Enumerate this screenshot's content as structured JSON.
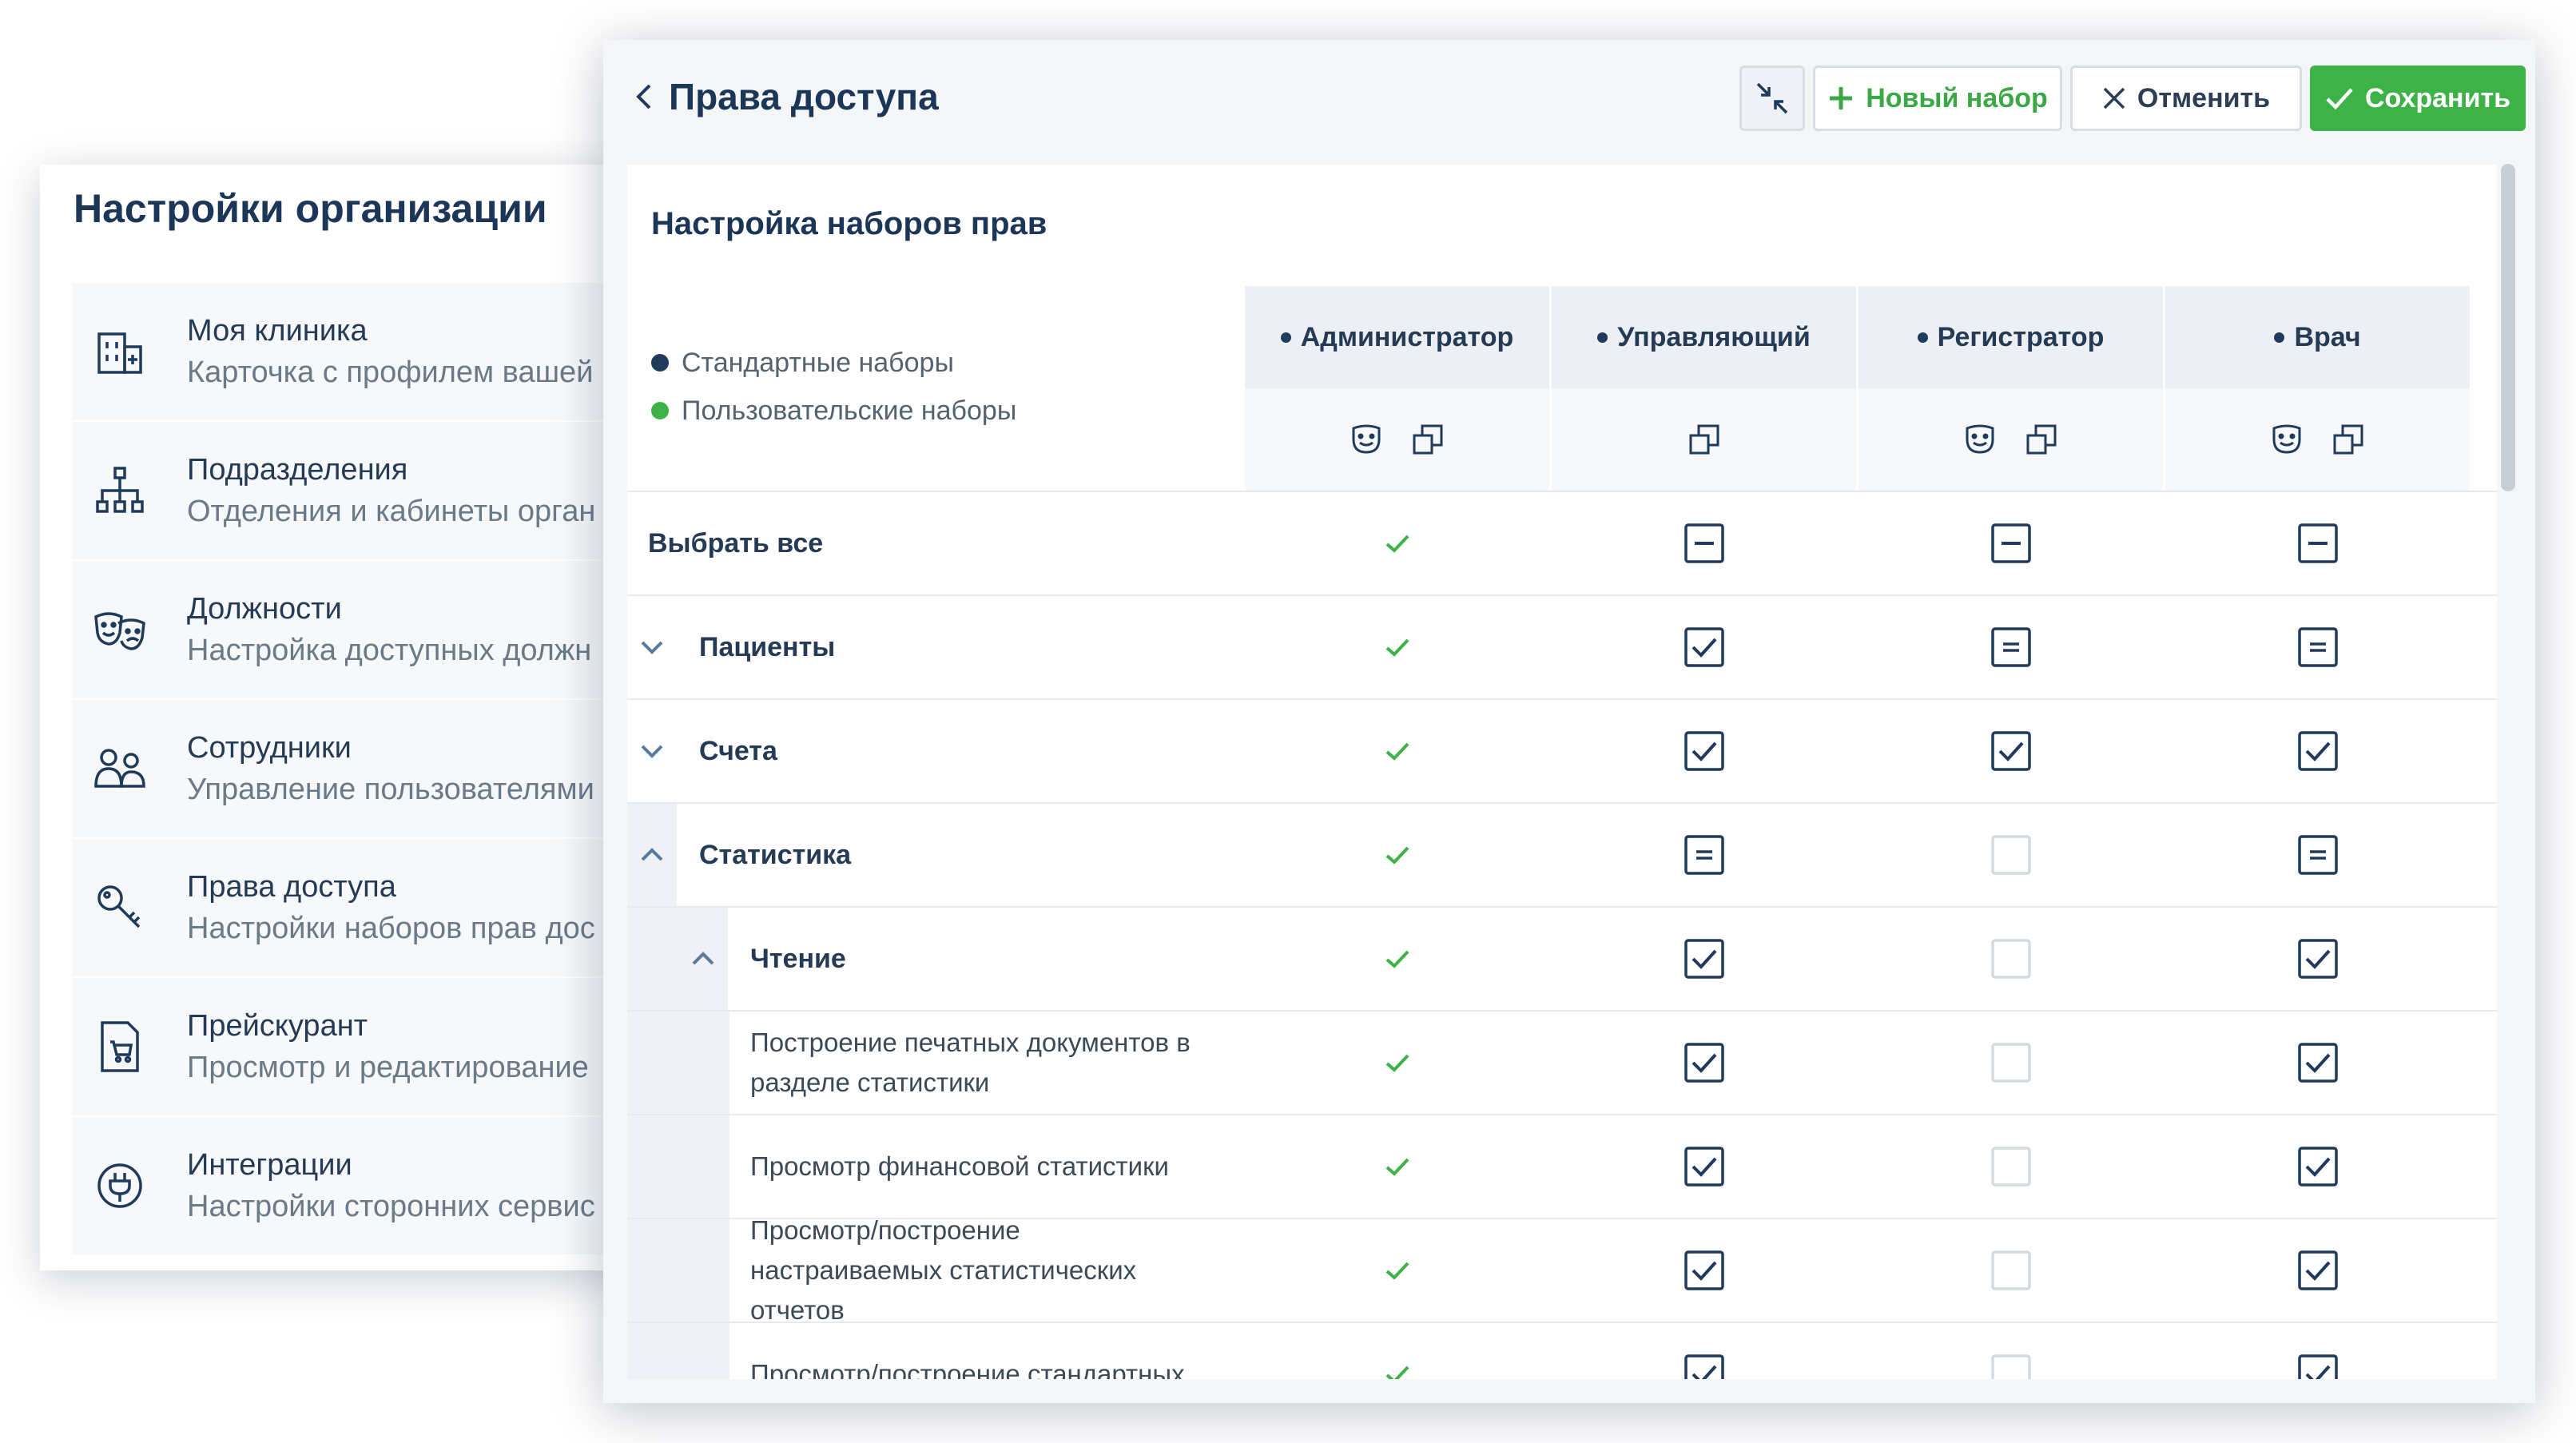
{
  "org_panel": {
    "title": "Настройки организации",
    "items": [
      {
        "icon": "building-icon",
        "name": "Моя клиника",
        "desc": "Карточка с профилем вашей"
      },
      {
        "icon": "hierarchy-icon",
        "name": "Подразделения",
        "desc": "Отделения и кабинеты орган"
      },
      {
        "icon": "theater-masks-icon",
        "name": "Должности",
        "desc": "Настройка доступных должн"
      },
      {
        "icon": "people-icon",
        "name": "Сотрудники",
        "desc": "Управление пользователями"
      },
      {
        "icon": "key-icon",
        "name": "Права доступа",
        "desc": "Настройки наборов прав дос"
      },
      {
        "icon": "price-list-icon",
        "name": "Прейскурант",
        "desc": "Просмотр и редактирование"
      },
      {
        "icon": "plug-icon",
        "name": "Интеграции",
        "desc": "Настройки сторонних сервис"
      }
    ]
  },
  "modal": {
    "title": "Права доступа",
    "buttons": {
      "new_set": "Новый набор",
      "cancel": "Отменить",
      "save": "Сохранить"
    },
    "card_title": "Настройка наборов прав",
    "legend": [
      {
        "label": "Стандартные наборы",
        "color": "#1f3a5a"
      },
      {
        "label": "Пользовательские наборы",
        "color": "#3db246"
      }
    ],
    "columns": [
      {
        "name": "Администратор",
        "icons": [
          "face-icon",
          "copy-icon"
        ]
      },
      {
        "name": "Управляющий",
        "icons": [
          "copy-icon"
        ]
      },
      {
        "name": "Регистратор",
        "icons": [
          "face-icon",
          "copy-icon"
        ]
      },
      {
        "name": "Врач",
        "icons": [
          "face-icon",
          "copy-icon"
        ]
      }
    ],
    "rows": [
      {
        "label": "Выбрать все",
        "level": 0,
        "bold": true,
        "caret": "none",
        "states": [
          "check",
          "minus",
          "minus",
          "minus"
        ]
      },
      {
        "label": "Пациенты",
        "level": 1,
        "bold": true,
        "caret": "down",
        "states": [
          "check",
          "checked",
          "equal",
          "equal"
        ]
      },
      {
        "label": "Счета",
        "level": 1,
        "bold": true,
        "caret": "down",
        "states": [
          "check",
          "checked",
          "checked",
          "checked"
        ]
      },
      {
        "label": "Статистика",
        "level": 1,
        "bold": true,
        "caret": "up",
        "states": [
          "check",
          "equal",
          "empty",
          "equal"
        ]
      },
      {
        "label": "Чтение",
        "level": 2,
        "bold": true,
        "caret": "up",
        "states": [
          "check",
          "checked",
          "empty",
          "checked"
        ]
      },
      {
        "label": "Построение печатных документов в разделе статистики",
        "level": 3,
        "bold": false,
        "caret": "none",
        "states": [
          "check",
          "checked",
          "empty",
          "checked"
        ]
      },
      {
        "label": "Просмотр финансовой статистики",
        "level": 3,
        "bold": false,
        "caret": "none",
        "states": [
          "check",
          "checked",
          "empty",
          "checked"
        ]
      },
      {
        "label": "Просмотр/построение настраиваемых статистических отчетов",
        "level": 3,
        "bold": false,
        "caret": "none",
        "states": [
          "check",
          "checked",
          "empty",
          "checked"
        ]
      },
      {
        "label": "Просмотр/построение стандартных",
        "level": 3,
        "bold": false,
        "caret": "none",
        "states": [
          "check",
          "checked",
          "empty",
          "checked"
        ]
      }
    ],
    "colors": {
      "accent_green": "#3db246",
      "navy": "#1f3a5a",
      "checkbox_empty": "#d4dae0"
    }
  }
}
